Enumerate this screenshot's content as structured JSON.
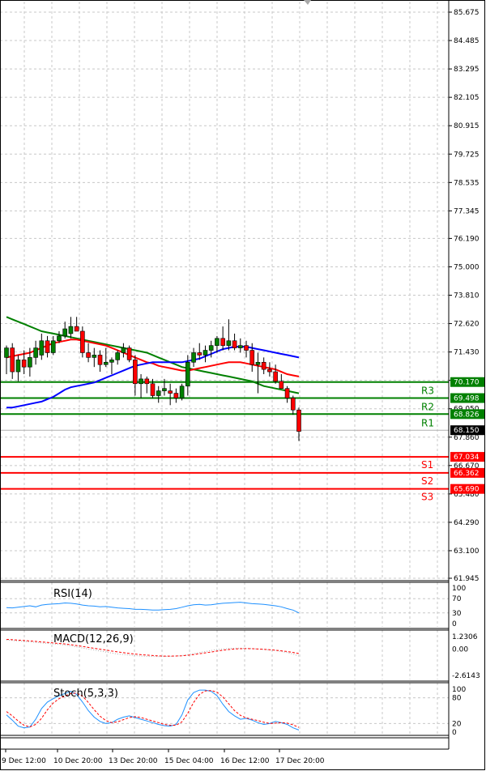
{
  "chart_data": {
    "type": "candlestick",
    "price_axis": {
      "ticks": [
        "85.675",
        "84.485",
        "83.295",
        "82.105",
        "80.915",
        "79.725",
        "78.535",
        "77.345",
        "76.190",
        "75.000",
        "73.810",
        "72.620",
        "71.430",
        "70.240",
        "69.050",
        "67.860",
        "66.670",
        "65.480",
        "64.290",
        "63.100",
        "61.945"
      ],
      "range": [
        61.945,
        85.675
      ]
    },
    "time_axis": {
      "labels": [
        "9 Dec 12:00",
        "10 Dec 20:00",
        "13 Dec 20:00",
        "15 Dec 04:00",
        "16 Dec 12:00",
        "17 Dec 20:00"
      ]
    },
    "candles": [
      {
        "o": 71.2,
        "h": 71.7,
        "l": 70.5,
        "c": 71.6
      },
      {
        "o": 71.6,
        "h": 71.8,
        "l": 70.3,
        "c": 70.6
      },
      {
        "o": 70.6,
        "h": 71.3,
        "l": 70.2,
        "c": 71.1
      },
      {
        "o": 71.1,
        "h": 71.5,
        "l": 70.5,
        "c": 70.8
      },
      {
        "o": 70.8,
        "h": 71.6,
        "l": 70.4,
        "c": 71.2
      },
      {
        "o": 71.2,
        "h": 71.9,
        "l": 70.9,
        "c": 71.6
      },
      {
        "o": 71.3,
        "h": 72.2,
        "l": 71.1,
        "c": 71.9
      },
      {
        "o": 71.9,
        "h": 72.1,
        "l": 71.2,
        "c": 71.4
      },
      {
        "o": 71.4,
        "h": 72.1,
        "l": 71.3,
        "c": 71.9
      },
      {
        "o": 71.9,
        "h": 72.3,
        "l": 71.8,
        "c": 72.1
      },
      {
        "o": 72.1,
        "h": 72.7,
        "l": 72.0,
        "c": 72.4
      },
      {
        "o": 72.2,
        "h": 72.9,
        "l": 72.0,
        "c": 72.5
      },
      {
        "o": 72.5,
        "h": 72.9,
        "l": 72.3,
        "c": 72.3
      },
      {
        "o": 72.3,
        "h": 72.5,
        "l": 71.2,
        "c": 71.4
      },
      {
        "o": 71.4,
        "h": 71.8,
        "l": 71.0,
        "c": 71.2
      },
      {
        "o": 71.2,
        "h": 71.6,
        "l": 70.8,
        "c": 71.3
      },
      {
        "o": 71.3,
        "h": 71.5,
        "l": 70.6,
        "c": 70.9
      },
      {
        "o": 70.9,
        "h": 71.6,
        "l": 70.8,
        "c": 71.0
      },
      {
        "o": 71.0,
        "h": 71.2,
        "l": 70.5,
        "c": 71.1
      },
      {
        "o": 71.1,
        "h": 71.5,
        "l": 70.9,
        "c": 71.4
      },
      {
        "o": 71.4,
        "h": 71.8,
        "l": 71.2,
        "c": 71.6
      },
      {
        "o": 71.6,
        "h": 71.7,
        "l": 71.0,
        "c": 71.1
      },
      {
        "o": 71.1,
        "h": 71.3,
        "l": 69.6,
        "c": 70.1
      },
      {
        "o": 70.1,
        "h": 70.5,
        "l": 69.5,
        "c": 70.3
      },
      {
        "o": 70.3,
        "h": 70.4,
        "l": 69.7,
        "c": 70.1
      },
      {
        "o": 70.1,
        "h": 70.3,
        "l": 69.5,
        "c": 69.6
      },
      {
        "o": 69.6,
        "h": 70.0,
        "l": 69.3,
        "c": 69.8
      },
      {
        "o": 69.8,
        "h": 70.3,
        "l": 69.6,
        "c": 69.9
      },
      {
        "o": 69.8,
        "h": 70.1,
        "l": 69.2,
        "c": 69.7
      },
      {
        "o": 69.7,
        "h": 69.9,
        "l": 69.3,
        "c": 69.5
      },
      {
        "o": 69.5,
        "h": 70.1,
        "l": 69.4,
        "c": 70.0
      },
      {
        "o": 70.0,
        "h": 71.3,
        "l": 69.6,
        "c": 71.0
      },
      {
        "o": 71.0,
        "h": 71.6,
        "l": 70.8,
        "c": 71.4
      },
      {
        "o": 71.4,
        "h": 71.8,
        "l": 71.1,
        "c": 71.3
      },
      {
        "o": 71.3,
        "h": 71.7,
        "l": 71.0,
        "c": 71.5
      },
      {
        "o": 71.5,
        "h": 71.9,
        "l": 71.2,
        "c": 71.7
      },
      {
        "o": 71.7,
        "h": 72.1,
        "l": 71.4,
        "c": 72.0
      },
      {
        "o": 72.0,
        "h": 72.5,
        "l": 71.5,
        "c": 71.7
      },
      {
        "o": 71.7,
        "h": 72.8,
        "l": 71.5,
        "c": 71.9
      },
      {
        "o": 71.9,
        "h": 72.2,
        "l": 71.5,
        "c": 71.6
      },
      {
        "o": 71.6,
        "h": 72.0,
        "l": 71.4,
        "c": 71.7
      },
      {
        "o": 71.7,
        "h": 71.9,
        "l": 71.2,
        "c": 71.5
      },
      {
        "o": 71.5,
        "h": 71.8,
        "l": 70.6,
        "c": 70.9
      },
      {
        "o": 70.9,
        "h": 71.4,
        "l": 69.7,
        "c": 71.0
      },
      {
        "o": 71.0,
        "h": 71.2,
        "l": 70.5,
        "c": 70.7
      },
      {
        "o": 70.7,
        "h": 71.0,
        "l": 70.4,
        "c": 70.6
      },
      {
        "o": 70.6,
        "h": 70.9,
        "l": 70.1,
        "c": 70.2
      },
      {
        "o": 70.2,
        "h": 70.5,
        "l": 69.9,
        "c": 69.9
      },
      {
        "o": 69.9,
        "h": 70.0,
        "l": 69.3,
        "c": 69.5
      },
      {
        "o": 69.5,
        "h": 69.6,
        "l": 68.8,
        "c": 69.0
      },
      {
        "o": 69.0,
        "h": 69.1,
        "l": 67.7,
        "c": 68.1
      }
    ],
    "moving_averages": [
      {
        "color": "#008000",
        "values": [
          72.9,
          72.8,
          72.7,
          72.6,
          72.5,
          72.4,
          72.3,
          72.25,
          72.2,
          72.15,
          72.1,
          72.05,
          72.0,
          71.95,
          71.9,
          71.85,
          71.8,
          71.75,
          71.7,
          71.65,
          71.6,
          71.55,
          71.5,
          71.45,
          71.4,
          71.3,
          71.2,
          71.1,
          71.0,
          70.9,
          70.8,
          70.75,
          70.7,
          70.65,
          70.6,
          70.55,
          70.5,
          70.45,
          70.4,
          70.35,
          70.3,
          70.25,
          70.2,
          70.1,
          70.0,
          69.95,
          69.9,
          69.85,
          69.8,
          69.75,
          69.7
        ]
      },
      {
        "color": "#ff0000",
        "values": [
          71.2,
          71.25,
          71.3,
          71.35,
          71.4,
          71.5,
          71.6,
          71.7,
          71.8,
          71.85,
          71.9,
          71.95,
          71.95,
          71.9,
          71.85,
          71.8,
          71.75,
          71.7,
          71.6,
          71.5,
          71.4,
          71.3,
          71.2,
          71.1,
          71.0,
          70.95,
          70.85,
          70.8,
          70.75,
          70.7,
          70.65,
          70.65,
          70.7,
          70.75,
          70.8,
          70.85,
          70.9,
          70.95,
          71.0,
          71.0,
          71.0,
          70.95,
          70.9,
          70.85,
          70.8,
          70.75,
          70.7,
          70.6,
          70.5,
          70.45,
          70.4
        ]
      },
      {
        "color": "#0000ff",
        "values": [
          69.1,
          69.1,
          69.15,
          69.2,
          69.25,
          69.3,
          69.35,
          69.45,
          69.55,
          69.7,
          69.85,
          69.95,
          70.0,
          70.05,
          70.1,
          70.15,
          70.25,
          70.35,
          70.45,
          70.55,
          70.65,
          70.75,
          70.85,
          70.9,
          70.95,
          71.0,
          71.0,
          71.0,
          71.0,
          71.0,
          71.0,
          71.05,
          71.1,
          71.15,
          71.25,
          71.35,
          71.45,
          71.55,
          71.6,
          71.65,
          71.65,
          71.65,
          71.6,
          71.55,
          71.5,
          71.45,
          71.4,
          71.35,
          71.3,
          71.25,
          71.2
        ]
      }
    ],
    "levels": [
      {
        "name": "R3",
        "value": 70.17,
        "tag": "70.170",
        "color": "#008000"
      },
      {
        "name": "R2",
        "value": 69.498,
        "tag": "69.498",
        "color": "#008000"
      },
      {
        "name": "R1",
        "value": 68.826,
        "tag": "68.826",
        "color": "#008000"
      },
      {
        "name": "S1",
        "value": 67.034,
        "tag": "67.034",
        "color": "#ff0000"
      },
      {
        "name": "S2",
        "value": 66.362,
        "tag": "66.362",
        "color": "#ff0000"
      },
      {
        "name": "S3",
        "value": 65.69,
        "tag": "65.690",
        "color": "#ff0000"
      }
    ],
    "current_price": "68.150",
    "indicators": {
      "rsi": {
        "label": "RSI(14)",
        "axis": [
          "100",
          "70",
          "30",
          "0"
        ],
        "range": [
          0,
          100
        ],
        "values": [
          45,
          44,
          46,
          48,
          50,
          47,
          52,
          54,
          55,
          56,
          58,
          57,
          55,
          52,
          50,
          49,
          47,
          48,
          46,
          44,
          43,
          42,
          40,
          40,
          39,
          38,
          38,
          39,
          40,
          42,
          46,
          50,
          53,
          54,
          52,
          53,
          55,
          57,
          58,
          59,
          60,
          58,
          56,
          55,
          54,
          52,
          50,
          47,
          42,
          38,
          30
        ]
      },
      "macd": {
        "label": "MACD(12,26,9)",
        "axis": [
          "1.2306",
          "0.00",
          "-2.6143"
        ],
        "range": [
          -2.6143,
          1.2306
        ],
        "main": [
          0.9,
          0.85,
          0.8,
          0.75,
          0.7,
          0.65,
          0.6,
          0.55,
          0.5,
          0.45,
          0.4,
          0.3,
          0.2,
          0.1,
          0.0,
          -0.1,
          -0.2,
          -0.3,
          -0.4,
          -0.5,
          -0.55,
          -0.6,
          -0.65,
          -0.7,
          -0.72,
          -0.74,
          -0.75,
          -0.74,
          -0.72,
          -0.7,
          -0.65,
          -0.55,
          -0.45,
          -0.35,
          -0.25,
          -0.15,
          -0.05,
          0.0,
          0.05,
          0.08,
          0.08,
          0.06,
          0.04,
          0.0,
          -0.05,
          -0.1,
          -0.15,
          -0.25,
          -0.35,
          -0.5,
          -0.7
        ],
        "signal": [
          0.95,
          0.92,
          0.88,
          0.84,
          0.8,
          0.75,
          0.7,
          0.65,
          0.6,
          0.55,
          0.5,
          0.42,
          0.34,
          0.25,
          0.16,
          0.07,
          -0.02,
          -0.1,
          -0.2,
          -0.28,
          -0.36,
          -0.44,
          -0.5,
          -0.56,
          -0.6,
          -0.64,
          -0.68,
          -0.7,
          -0.7,
          -0.69,
          -0.67,
          -0.62,
          -0.55,
          -0.47,
          -0.38,
          -0.3,
          -0.2,
          -0.12,
          -0.05,
          0.0,
          0.03,
          0.04,
          0.03,
          0.0,
          -0.03,
          -0.07,
          -0.12,
          -0.18,
          -0.25,
          -0.34,
          -0.45
        ]
      },
      "stoch": {
        "label": "Stoch(5,3,3)",
        "axis": [
          "100",
          "80",
          "20",
          "0"
        ],
        "range": [
          0,
          100
        ],
        "k": [
          40,
          28,
          14,
          10,
          12,
          30,
          55,
          70,
          78,
          85,
          90,
          95,
          88,
          70,
          50,
          35,
          25,
          20,
          22,
          30,
          35,
          38,
          34,
          30,
          26,
          22,
          18,
          15,
          14,
          18,
          40,
          75,
          92,
          98,
          98,
          95,
          85,
          65,
          48,
          38,
          30,
          32,
          28,
          22,
          18,
          20,
          25,
          22,
          18,
          10,
          5
        ],
        "d": [
          48,
          38,
          26,
          16,
          12,
          18,
          32,
          52,
          68,
          78,
          84,
          90,
          91,
          84,
          69,
          52,
          37,
          27,
          22,
          24,
          29,
          34,
          36,
          34,
          30,
          26,
          22,
          18,
          16,
          16,
          24,
          44,
          69,
          88,
          96,
          97,
          93,
          82,
          66,
          50,
          39,
          33,
          30,
          27,
          23,
          20,
          21,
          22,
          21,
          17,
          11
        ]
      }
    }
  }
}
